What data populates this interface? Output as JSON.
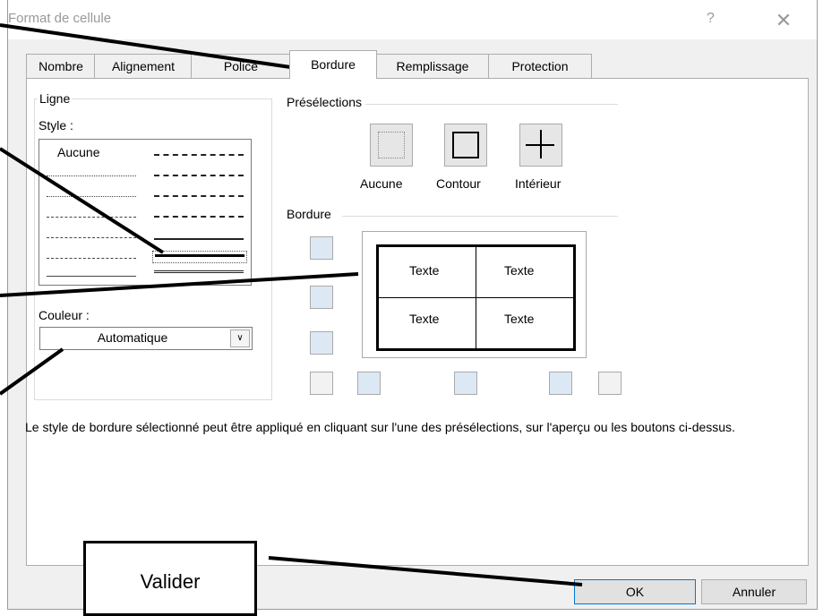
{
  "window": {
    "title": "Format de cellule",
    "help_label": "?",
    "close_label": "✕"
  },
  "tabs": [
    {
      "label": "Nombre"
    },
    {
      "label": "Alignement"
    },
    {
      "label": "Police"
    },
    {
      "label": "Bordure",
      "active": true
    },
    {
      "label": "Remplissage"
    },
    {
      "label": "Protection"
    }
  ],
  "line_group": {
    "legend": "Ligne",
    "style_label": "Style :",
    "style_none": "Aucune",
    "color_label": "Couleur :",
    "color_value": "Automatique"
  },
  "presets": {
    "legend": "Présélections",
    "items": [
      {
        "label": "Aucune"
      },
      {
        "label": "Contour"
      },
      {
        "label": "Intérieur"
      }
    ]
  },
  "border_group": {
    "legend": "Bordure",
    "cells": [
      "Texte",
      "Texte",
      "Texte",
      "Texte"
    ]
  },
  "description": "Le style de bordure sélectionné peut être appliqué en cliquant sur l'une des présélections, sur l'aperçu ou les boutons ci-dessus.",
  "buttons": {
    "ok": "OK",
    "cancel": "Annuler"
  },
  "annotation": {
    "text": "Valider"
  }
}
